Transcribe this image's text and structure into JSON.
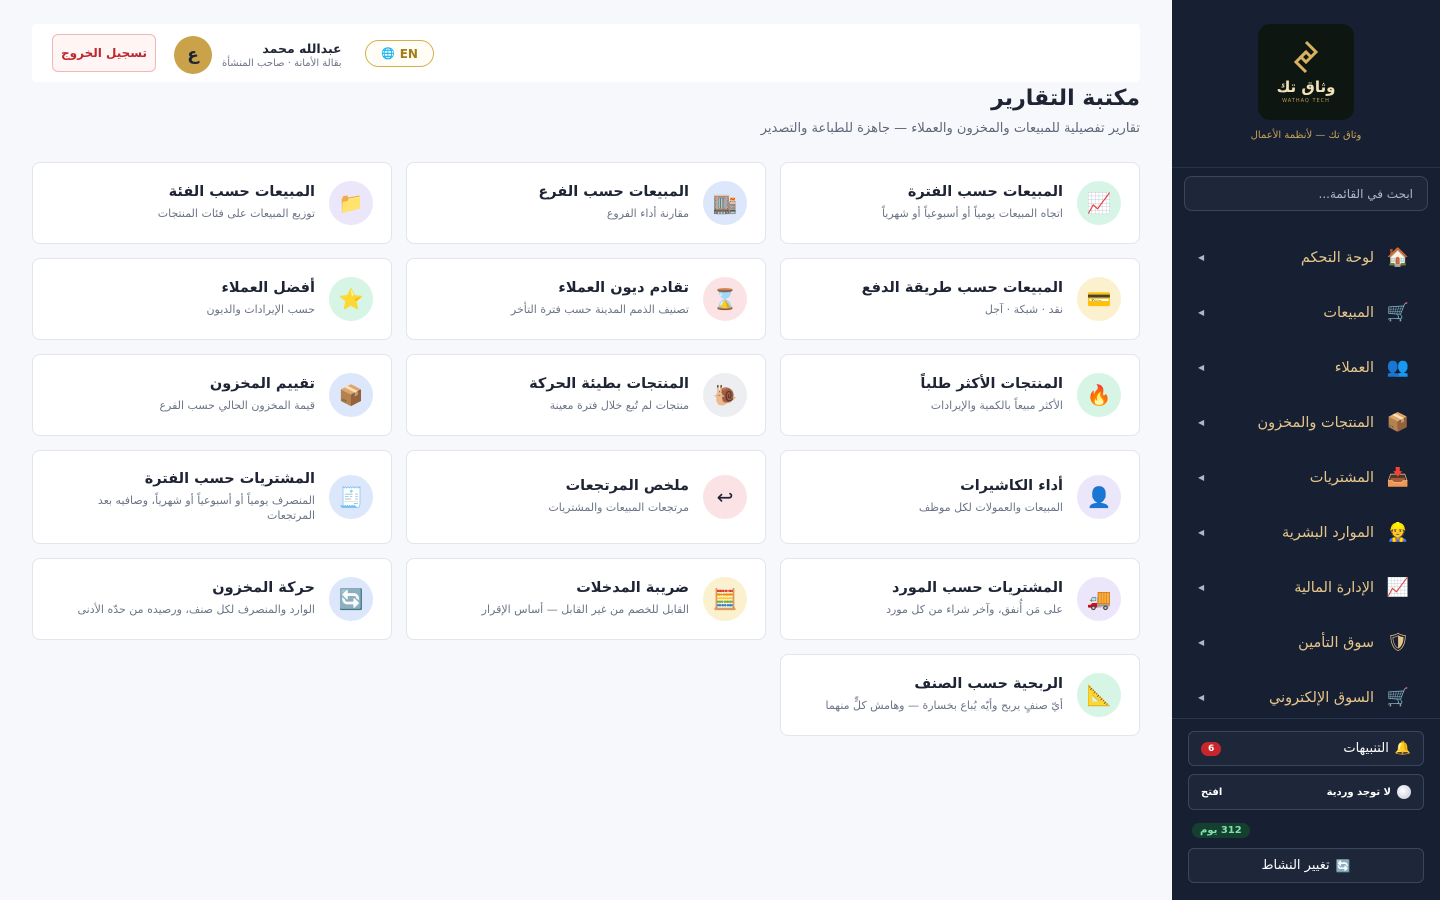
{
  "header": {
    "logout_label": "تسجيل الخروج",
    "user_name": "عبدالله محمد",
    "user_role": "بقالة الأمانة · صاحب المنشأة",
    "avatar_letter": "ع",
    "lang_label": "EN"
  },
  "page": {
    "title": "مكتبة التقارير",
    "subtitle": "تقارير تفصيلية للمبيعات والمخزون والعملاء — جاهزة للطباعة والتصدير"
  },
  "cards": [
    {
      "title": "المبيعات حسب الفترة",
      "desc": "اتجاه المبيعات يومياً أو أسبوعياً أو شهرياً",
      "icon": "chart-up-icon",
      "glyph": "📈"
    },
    {
      "title": "المبيعات حسب الفرع",
      "desc": "مقارنة أداء الفروع",
      "icon": "building-icon",
      "glyph": "🏬"
    },
    {
      "title": "المبيعات حسب الفئة",
      "desc": "توزيع المبيعات على فئات المنتجات",
      "icon": "folder-icon",
      "glyph": "📁"
    },
    {
      "title": "المبيعات حسب طريقة الدفع",
      "desc": "نقد · شبكة · آجل",
      "icon": "credit-card-icon",
      "glyph": "💳"
    },
    {
      "title": "تقادم ديون العملاء",
      "desc": "تصنيف الذمم المدينة حسب فترة التأخر",
      "icon": "hourglass-icon",
      "glyph": "⌛"
    },
    {
      "title": "أفضل العملاء",
      "desc": "حسب الإيرادات والديون",
      "icon": "star-icon",
      "glyph": "⭐"
    },
    {
      "title": "المنتجات الأكثر طلباً",
      "desc": "الأكثر مبيعاً بالكمية والإيرادات",
      "icon": "fire-icon",
      "glyph": "🔥"
    },
    {
      "title": "المنتجات بطيئة الحركة",
      "desc": "منتجات لم تُبع خلال فترة معينة",
      "icon": "snail-icon",
      "glyph": "🐌"
    },
    {
      "title": "تقييم المخزون",
      "desc": "قيمة المخزون الحالي حسب الفرع",
      "icon": "box-icon",
      "glyph": "📦"
    },
    {
      "title": "أداء الكاشيرات",
      "desc": "المبيعات والعمولات لكل موظف",
      "icon": "person-icon",
      "glyph": "👤"
    },
    {
      "title": "ملخص المرتجعات",
      "desc": "مرتجعات المبيعات والمشتريات",
      "icon": "return-arrow-icon",
      "glyph": "↩"
    },
    {
      "title": "المشتريات حسب الفترة",
      "desc": "المنصرف يومياً أو أسبوعياً أو شهرياً، وصافيه بعد المرتجعات",
      "icon": "receipt-icon",
      "glyph": "🧾"
    },
    {
      "title": "المشتريات حسب المورد",
      "desc": "على مَن أُنفق، وآخر شراء من كل مورد",
      "icon": "truck-icon",
      "glyph": "🚚"
    },
    {
      "title": "ضريبة المدخلات",
      "desc": "القابل للخصم من غير القابل — أساس الإقرار",
      "icon": "abacus-icon",
      "glyph": "🧮"
    },
    {
      "title": "حركة المخزون",
      "desc": "الوارد والمنصرف لكل صنف، ورصيده من حدّه الأدنى",
      "icon": "refresh-icon",
      "glyph": "🔄"
    },
    {
      "title": "الربحية حسب الصنف",
      "desc": "أيّ صنفٍ يربح وأيّه يُباع بخسارة — وهامش كلٍّ منهما",
      "icon": "triangle-ruler-icon",
      "glyph": "📐"
    }
  ],
  "sidebar": {
    "brand_name": "وثاق تك",
    "brand_tag": "WATHAQ TECH",
    "brand_caption": "وثاق تك — لأنظمة الأعمال",
    "search_placeholder": "ابحث في القائمة...",
    "items": [
      {
        "label": "لوحة التحكم",
        "icon": "house-icon",
        "glyph": "🏠"
      },
      {
        "label": "المبيعات",
        "icon": "cart-icon",
        "glyph": "🛒"
      },
      {
        "label": "العملاء",
        "icon": "people-icon",
        "glyph": "👥"
      },
      {
        "label": "المنتجات والمخزون",
        "icon": "box-icon",
        "glyph": "📦"
      },
      {
        "label": "المشتريات",
        "icon": "inbox-icon",
        "glyph": "📥"
      },
      {
        "label": "الموارد البشرية",
        "icon": "worker-icon",
        "glyph": "👷"
      },
      {
        "label": "الإدارة المالية",
        "icon": "chart-up-icon",
        "glyph": "📈"
      },
      {
        "label": "سوق التأمين",
        "icon": "shield-icon",
        "glyph": "🛡"
      },
      {
        "label": "السوق الإلكتروني",
        "icon": "cart-icon",
        "glyph": "🛒"
      }
    ],
    "alerts_label": "التنبيهات",
    "alerts_count": "6",
    "shift_label": "لا توجد وردية",
    "shift_action": "افتح",
    "days_badge": "312 يوم",
    "switch_label": "تغيير النشاط"
  }
}
